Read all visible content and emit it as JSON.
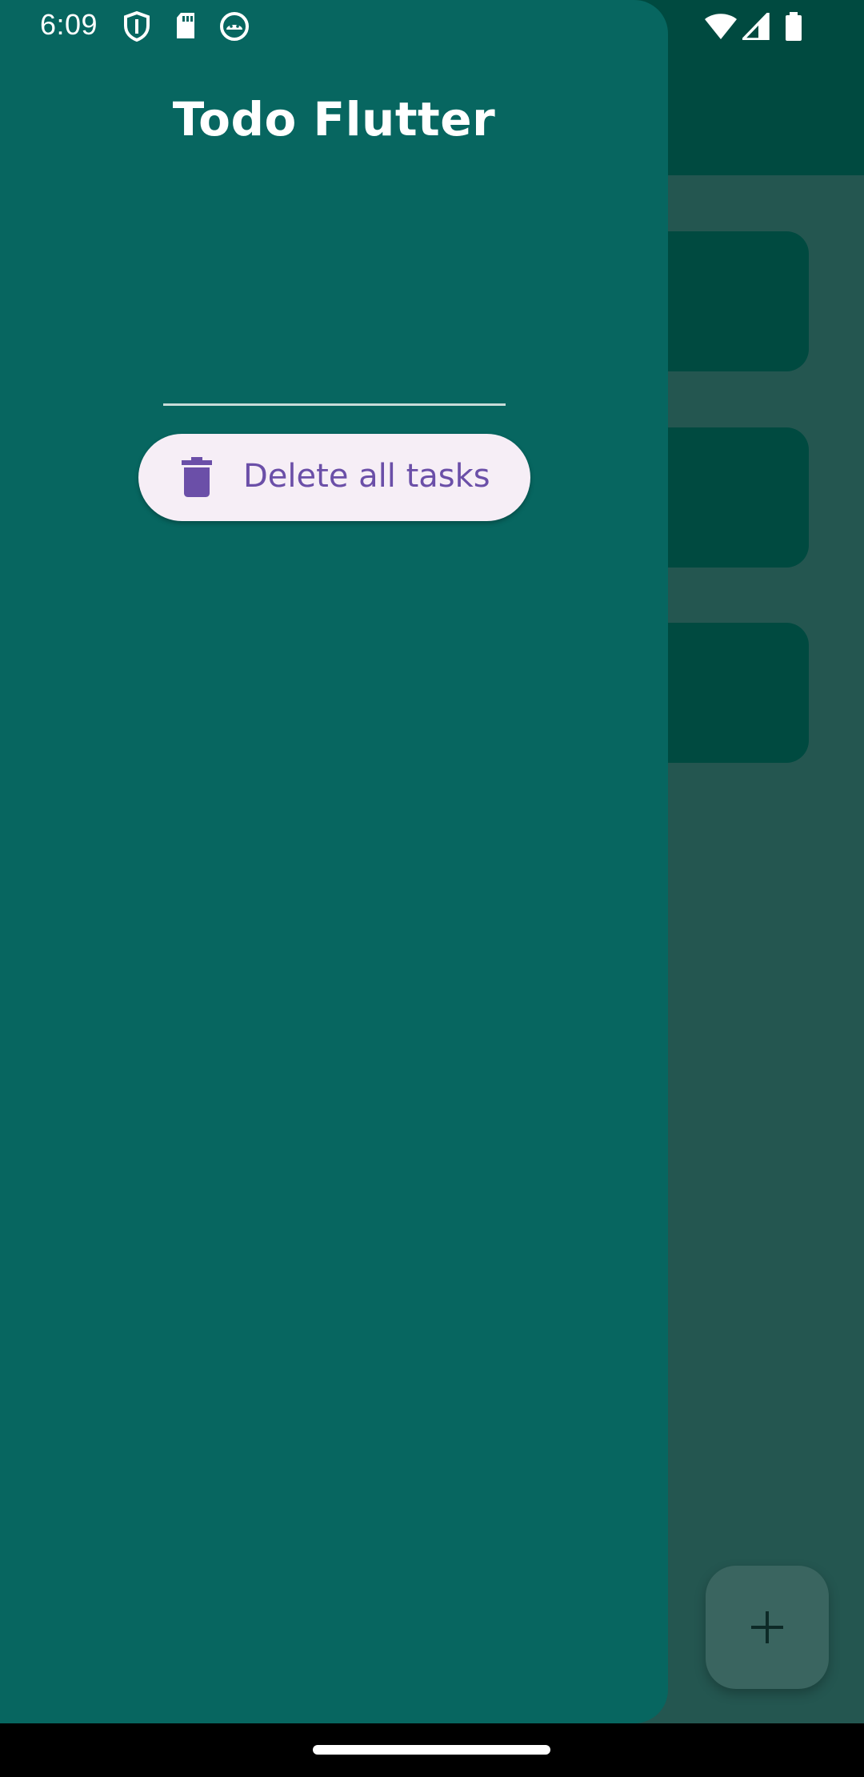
{
  "status_bar": {
    "time": "6:09",
    "left_icons": [
      "shield-icon",
      "sd-card-icon",
      "android-debug-icon"
    ],
    "right_icons": [
      "wifi-icon",
      "cell-signal-icon",
      "battery-icon"
    ]
  },
  "drawer": {
    "title": "Todo Flutter",
    "delete_button": {
      "label": "Delete all tasks",
      "icon": "trash-icon"
    }
  },
  "main": {
    "fab_icon": "plus-icon",
    "task_cards": 3
  },
  "colors": {
    "app_bar": "#004a40",
    "drawer": "#076660",
    "scrim_bg": "#245650",
    "button_bg": "#f6eef6",
    "button_fg": "#6b4fa8"
  }
}
